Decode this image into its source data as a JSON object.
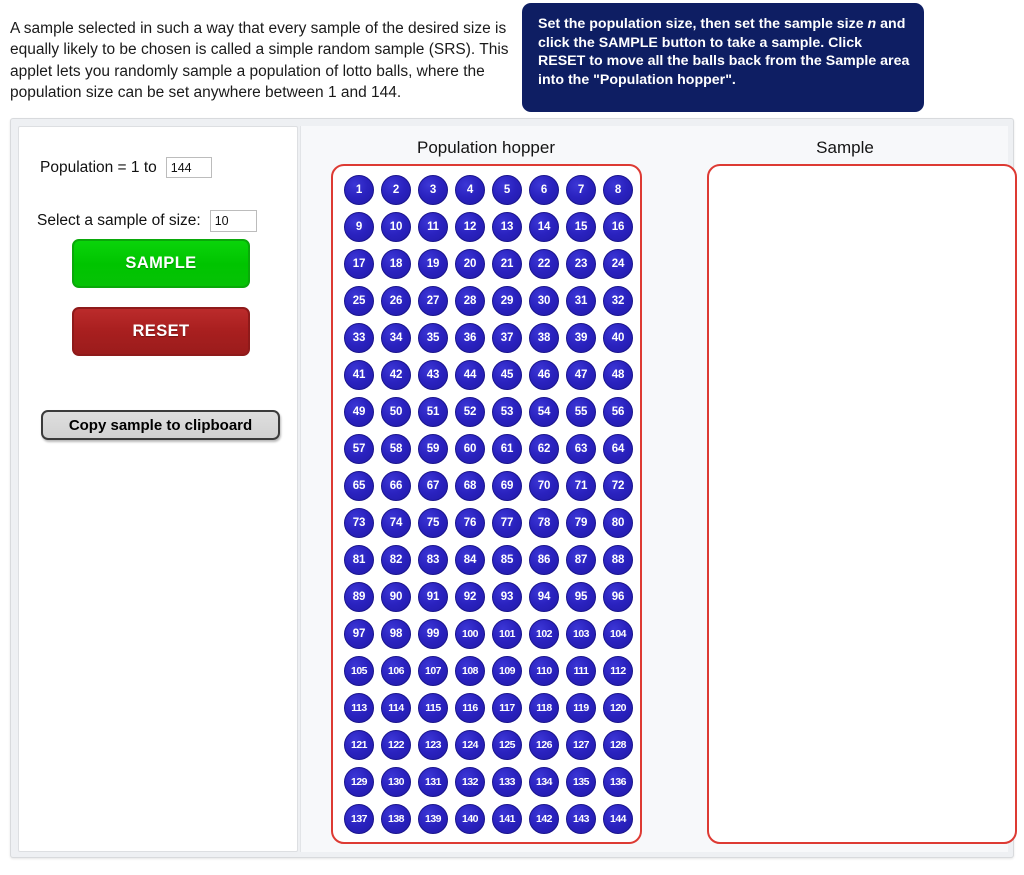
{
  "intro": {
    "text": "A sample selected in such a way that every sample of the desired size is equally likely to be chosen is called a simple random sample (SRS). This applet lets you randomly sample a population of lotto balls, where the population size can be set anywhere between 1 and 144."
  },
  "instructions": {
    "part1": "Set the population size, then set the sample size ",
    "emphasis": "n",
    "part2": " and click the SAMPLE button to take a sample. Click RESET to move all the balls back from the Sample area into the \"Population hopper\".",
    "background_color": "#0e1e63",
    "text_color": "#ffffff"
  },
  "controls": {
    "population_label": "Population = 1 to",
    "population_value": "144",
    "population_placeholder": "144",
    "sample_size_label": "Select a sample of size:",
    "sample_size_value": "10",
    "sample_size_placeholder": "10",
    "sample_button_label": "SAMPLE",
    "sample_button_color": "#00c400",
    "reset_button_label": "RESET",
    "reset_button_color": "#a81f1f",
    "copy_button_label": "Copy sample to clipboard"
  },
  "hopper": {
    "title": "Population hopper",
    "border_color": "#dd3a33",
    "ball_color": "#2a22bf",
    "ball_text_color": "#ffffff",
    "balls": [
      "1",
      "2",
      "3",
      "4",
      "5",
      "6",
      "7",
      "8",
      "9",
      "10",
      "11",
      "12",
      "13",
      "14",
      "15",
      "16",
      "17",
      "18",
      "19",
      "20",
      "21",
      "22",
      "23",
      "24",
      "25",
      "26",
      "27",
      "28",
      "29",
      "30",
      "31",
      "32",
      "33",
      "34",
      "35",
      "36",
      "37",
      "38",
      "39",
      "40",
      "41",
      "42",
      "43",
      "44",
      "45",
      "46",
      "47",
      "48",
      "49",
      "50",
      "51",
      "52",
      "53",
      "54",
      "55",
      "56",
      "57",
      "58",
      "59",
      "60",
      "61",
      "62",
      "63",
      "64",
      "65",
      "66",
      "67",
      "68",
      "69",
      "70",
      "71",
      "72",
      "73",
      "74",
      "75",
      "76",
      "77",
      "78",
      "79",
      "80",
      "81",
      "82",
      "83",
      "84",
      "85",
      "86",
      "87",
      "88",
      "89",
      "90",
      "91",
      "92",
      "93",
      "94",
      "95",
      "96",
      "97",
      "98",
      "99",
      "100",
      "101",
      "102",
      "103",
      "104",
      "105",
      "106",
      "107",
      "108",
      "109",
      "110",
      "111",
      "112",
      "113",
      "114",
      "115",
      "116",
      "117",
      "118",
      "119",
      "120",
      "121",
      "122",
      "123",
      "124",
      "125",
      "126",
      "127",
      "128",
      "129",
      "130",
      "131",
      "132",
      "133",
      "134",
      "135",
      "136",
      "137",
      "138",
      "139",
      "140",
      "141",
      "142",
      "143",
      "144"
    ]
  },
  "sample": {
    "title": "Sample",
    "border_color": "#dd3a33",
    "balls": []
  }
}
